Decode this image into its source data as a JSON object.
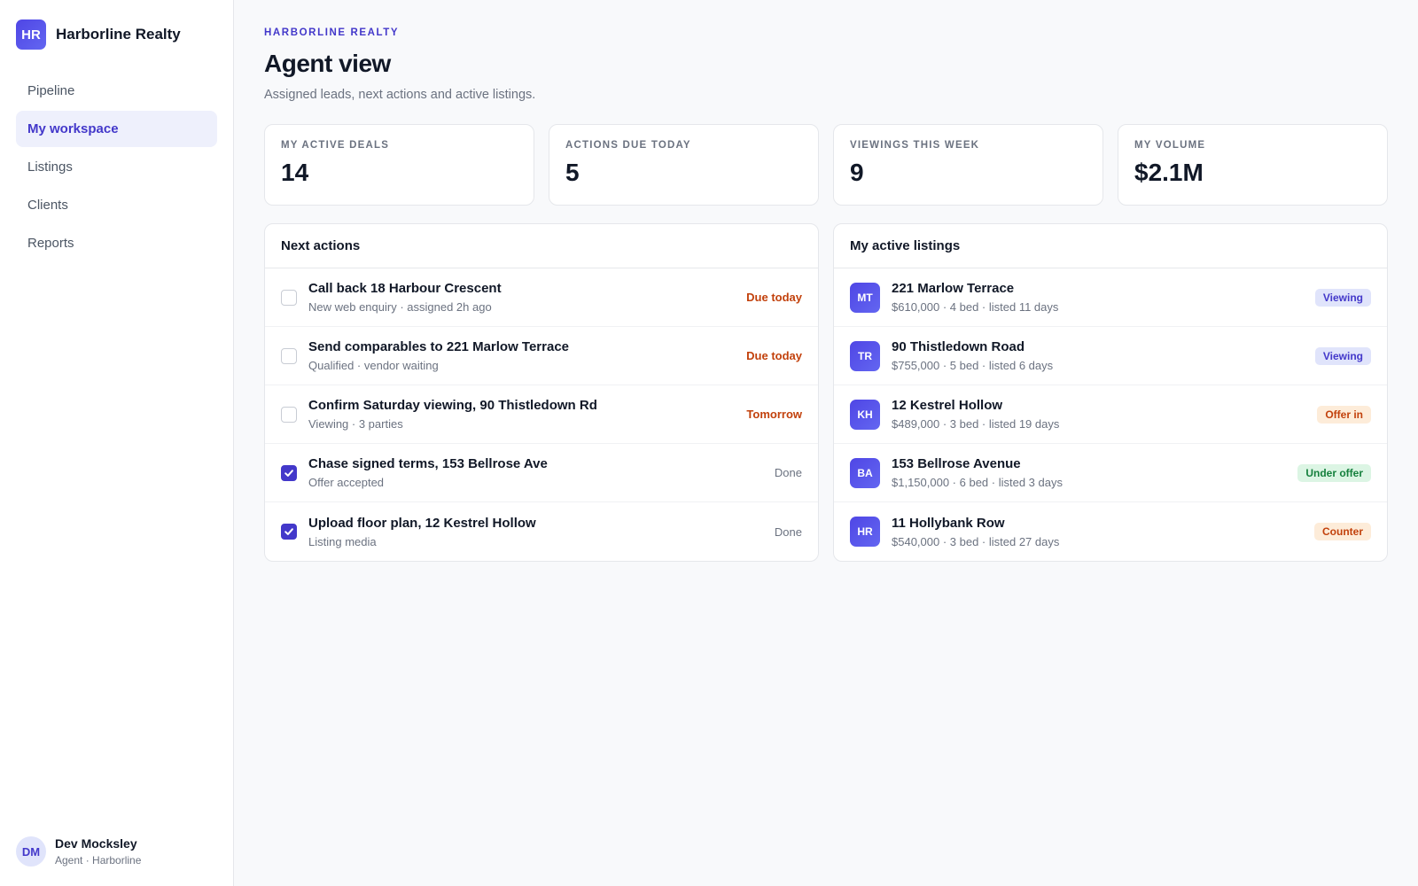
{
  "brand": {
    "initials": "HR",
    "name": "Harborline Realty"
  },
  "nav": [
    {
      "label": "Pipeline",
      "active": false
    },
    {
      "label": "My workspace",
      "active": true
    },
    {
      "label": "Listings",
      "active": false
    },
    {
      "label": "Clients",
      "active": false
    },
    {
      "label": "Reports",
      "active": false
    }
  ],
  "user": {
    "initials": "DM",
    "name": "Dev Mocksley",
    "role": "Agent · Harborline"
  },
  "header": {
    "eyebrow": "HARBORLINE REALTY",
    "title": "Agent view",
    "subtitle": "Assigned leads, next actions and active listings."
  },
  "stats": [
    {
      "label": "MY ACTIVE DEALS",
      "value": "14"
    },
    {
      "label": "ACTIONS DUE TODAY",
      "value": "5"
    },
    {
      "label": "VIEWINGS THIS WEEK",
      "value": "9"
    },
    {
      "label": "MY VOLUME",
      "value": "$2.1M"
    }
  ],
  "actions": {
    "title": "Next actions",
    "items": [
      {
        "title": "Call back 18 Harbour Crescent",
        "sub": "New web enquiry · assigned 2h ago",
        "due": "Due today",
        "checked": false
      },
      {
        "title": "Send comparables to 221 Marlow Terrace",
        "sub": "Qualified · vendor waiting",
        "due": "Due today",
        "checked": false
      },
      {
        "title": "Confirm Saturday viewing, 90 Thistledown Rd",
        "sub": "Viewing · 3 parties",
        "due": "Tomorrow",
        "checked": false
      },
      {
        "title": "Chase signed terms, 153 Bellrose Ave",
        "sub": "Offer accepted",
        "due": "Done",
        "checked": true
      },
      {
        "title": "Upload floor plan, 12 Kestrel Hollow",
        "sub": "Listing media",
        "due": "Done",
        "checked": true
      }
    ]
  },
  "listings": {
    "title": "My active listings",
    "items": [
      {
        "initials": "MT",
        "title": "221 Marlow Terrace",
        "sub": "$610,000 · 4 bed · listed 11 days",
        "status": "Viewing"
      },
      {
        "initials": "TR",
        "title": "90 Thistledown Road",
        "sub": "$755,000 · 5 bed · listed 6 days",
        "status": "Viewing"
      },
      {
        "initials": "KH",
        "title": "12 Kestrel Hollow",
        "sub": "$489,000 · 3 bed · listed 19 days",
        "status": "Offer in"
      },
      {
        "initials": "BA",
        "title": "153 Bellrose Avenue",
        "sub": "$1,150,000 · 6 bed · listed 3 days",
        "status": "Under offer"
      },
      {
        "initials": "HR",
        "title": "11 Hollybank Row",
        "sub": "$540,000 · 3 bed · listed 27 days",
        "status": "Counter"
      }
    ]
  },
  "colors": {
    "accent": "#4338ca",
    "urgent": "#c2410c",
    "success": "#15803d"
  }
}
